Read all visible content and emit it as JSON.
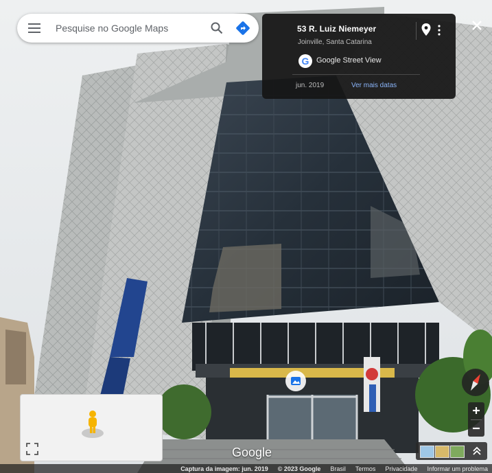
{
  "search": {
    "placeholder": "Pesquise no Google Maps"
  },
  "info_card": {
    "address": "53 R. Luiz Niemeyer",
    "city": "Joinville, Santa Catarina",
    "source": "Google Street View",
    "date": "jun. 2019",
    "more_dates": "Ver mais datas"
  },
  "icons": {
    "menu": "hamburger-menu-icon",
    "search": "search-icon",
    "directions": "directions-icon",
    "pin": "map-pin-icon",
    "more": "more-vert-icon",
    "close": "close-icon",
    "compass": "compass-icon",
    "pegman": "pegman-icon",
    "expand": "fullscreen-icon",
    "thumb_toggle": "chevron-up-icon"
  },
  "watermark": "Google",
  "zoom": {
    "in_label": "+",
    "out_label": "−"
  },
  "footer": {
    "capture": "Captura da imagem: jun. 2019",
    "copyright": "© 2023 Google",
    "links": [
      "Brasil",
      "Termos",
      "Privacidade",
      "Informar um problema"
    ]
  },
  "colors": {
    "accent": "#1a73e8",
    "card_bg": "#161616",
    "link": "#8ab4f8"
  }
}
